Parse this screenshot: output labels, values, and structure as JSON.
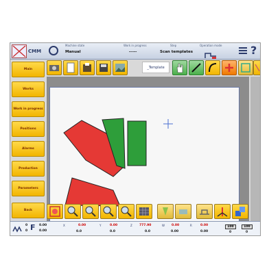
{
  "header": {
    "brand": "CMM",
    "machine_state_label": "Machine state",
    "machine_state_value": "Manual",
    "work_in_progress_label": "Work in progress",
    "work_in_progress_value": "-----",
    "step_label": "Step",
    "step_value": "Scan templates",
    "operation_mode_label": "Operation mode"
  },
  "sidebar": {
    "items": [
      {
        "label": "Main"
      },
      {
        "label": "Works"
      },
      {
        "label": "Work in progress"
      },
      {
        "label": "Positions"
      },
      {
        "label": "Alarms"
      },
      {
        "label": "Production"
      },
      {
        "label": "Parameters"
      },
      {
        "label": "Back"
      }
    ]
  },
  "toolbar": {
    "template_tab": "_Template",
    "icons": [
      "camera-icon",
      "sheet-icon",
      "drawing-icon",
      "save-icon",
      "photo-icon",
      "hand-icon",
      "line-icon",
      "arc-icon",
      "plus-icon",
      "fit-icon",
      "warning-icon"
    ]
  },
  "bottom_toolbar": {
    "icons": [
      "select-icon",
      "zoom-in-icon",
      "zoom-out-icon",
      "zoom-area-icon",
      "zoom-fit-icon",
      "grid-icon",
      "ruler-icon",
      "layer-icon",
      "measure-icon",
      "axis-icon",
      "transform-icon"
    ]
  },
  "status": {
    "f_label": "F",
    "f_values": [
      "0.00",
      "0.00"
    ],
    "x_label": "X",
    "x_value": "0.00",
    "x_sub": "0.0",
    "y_label": "Y",
    "y_value": "0.00",
    "y_sub": "0.0",
    "z_label": "Z",
    "z_value": "777.90",
    "z_sub": "0.0",
    "w_label": "W",
    "w_value": "0.00",
    "w_sub": "0.00",
    "r_label": "R",
    "r_value": "0.00",
    "r_sub": "0.00",
    "speed_value": "100",
    "speed_sub": "0",
    "mode_value": "0",
    "percent_value": "100",
    "percent_sub": "0"
  },
  "colors": {
    "sidebar_button": "#f2b500",
    "shape_red": "#e53935",
    "shape_green": "#2e9e3a",
    "canvas_bg": "#8c8c8c",
    "header_text": "#2b3a6b"
  }
}
